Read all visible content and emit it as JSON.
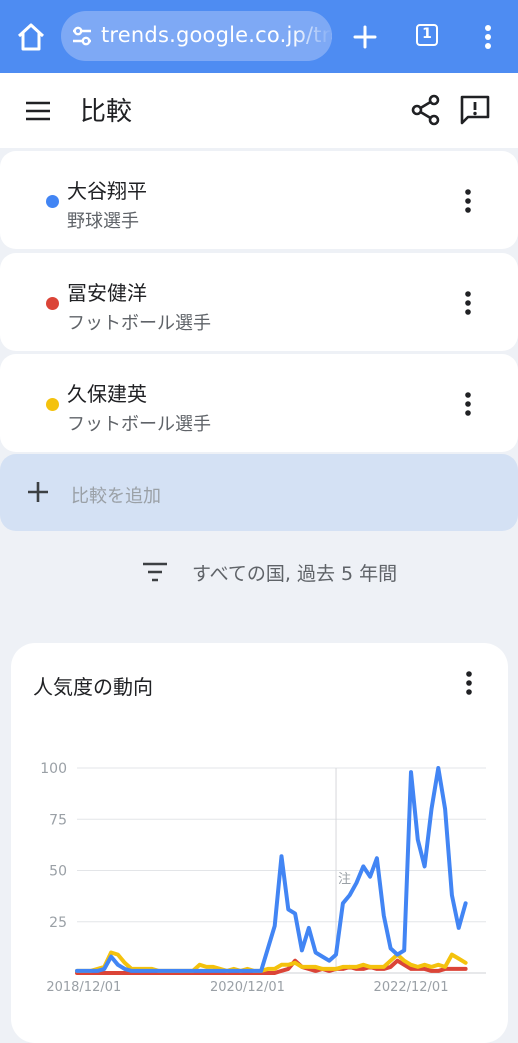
{
  "browser": {
    "url": "trends.google.co.jp/trends/explore",
    "tab_count": "1"
  },
  "header": {
    "title": "比較"
  },
  "terms": [
    {
      "name": "大谷翔平",
      "category": "野球選手",
      "color": "#4285f4"
    },
    {
      "name": "冨安健洋",
      "category": "フットボール選手",
      "color": "#db4437"
    },
    {
      "name": "久保建英",
      "category": "フットボール選手",
      "color": "#f4c20d"
    }
  ],
  "add_compare": {
    "label": "比較を追加"
  },
  "filter": {
    "label": "すべての国, 過去 5 年間"
  },
  "chart_card": {
    "title": "人気度の動向"
  },
  "icons": {
    "home": "home-icon",
    "tune": "tune-icon",
    "plus": "plus-icon",
    "tabs": "tabs-icon",
    "menu": "more-vert-icon",
    "hamburger": "menu-icon",
    "share": "share-icon",
    "feedback": "feedback-icon",
    "filter": "filter-icon"
  },
  "chart_data": {
    "type": "line",
    "title": "",
    "xlabel": "",
    "ylabel": "",
    "ylim": [
      0,
      100
    ],
    "yticks": [
      "100",
      "75",
      "50",
      "25"
    ],
    "xticks": [
      "2018/12/01",
      "2020/12/01",
      "2022/12/01"
    ],
    "note_label": "注",
    "grid": true,
    "legend": "none",
    "x": [
      "2018-11",
      "2018-12",
      "2019-01",
      "2019-02",
      "2019-03",
      "2019-04",
      "2019-05",
      "2019-06",
      "2019-07",
      "2019-08",
      "2019-09",
      "2019-10",
      "2019-11",
      "2019-12",
      "2020-01",
      "2020-02",
      "2020-03",
      "2020-04",
      "2020-05",
      "2020-06",
      "2020-07",
      "2020-08",
      "2020-09",
      "2020-10",
      "2020-11",
      "2020-12",
      "2021-01",
      "2021-02",
      "2021-03",
      "2021-04",
      "2021-05",
      "2021-06",
      "2021-07",
      "2021-08",
      "2021-09",
      "2021-10",
      "2021-11",
      "2021-12",
      "2022-01",
      "2022-02",
      "2022-03",
      "2022-04",
      "2022-05",
      "2022-06",
      "2022-07",
      "2022-08",
      "2022-09",
      "2022-10",
      "2022-11",
      "2022-12",
      "2023-01",
      "2023-02",
      "2023-03",
      "2023-04",
      "2023-05",
      "2023-06",
      "2023-07",
      "2023-08",
      "2023-09",
      "2023-10",
      "2023-11"
    ],
    "series": [
      {
        "name": "大谷翔平",
        "color": "#4285f4",
        "values": [
          1,
          1,
          1,
          1,
          2,
          8,
          4,
          2,
          1,
          1,
          1,
          1,
          1,
          1,
          1,
          1,
          1,
          1,
          1,
          1,
          1,
          1,
          1,
          1,
          1,
          1,
          1,
          1,
          12,
          23,
          57,
          31,
          29,
          11,
          22,
          10,
          8,
          6,
          9,
          34,
          38,
          44,
          52,
          47,
          56,
          28,
          12,
          9,
          11,
          98,
          65,
          52,
          80,
          100,
          80,
          38,
          22,
          34
        ]
      },
      {
        "name": "冨安健洋",
        "color": "#db4437",
        "values": [
          0,
          0,
          0,
          0,
          0,
          0,
          0,
          0,
          0,
          0,
          0,
          0,
          0,
          0,
          0,
          0,
          0,
          0,
          0,
          0,
          0,
          0,
          0,
          0,
          0,
          0,
          0,
          0,
          0,
          0,
          1,
          2,
          6,
          3,
          2,
          1,
          2,
          1,
          2,
          2,
          3,
          2,
          2,
          3,
          2,
          2,
          3,
          6,
          4,
          2,
          2,
          2,
          1,
          1,
          2,
          2,
          2,
          2
        ]
      },
      {
        "name": "久保建英",
        "color": "#f4c20d",
        "values": [
          1,
          1,
          1,
          2,
          3,
          10,
          9,
          5,
          2,
          2,
          2,
          2,
          1,
          1,
          1,
          1,
          1,
          1,
          4,
          3,
          3,
          2,
          1,
          2,
          1,
          2,
          1,
          1,
          2,
          2,
          4,
          4,
          5,
          3,
          3,
          3,
          2,
          2,
          2,
          3,
          3,
          3,
          4,
          3,
          3,
          3,
          6,
          9,
          6,
          4,
          3,
          4,
          3,
          4,
          3,
          9,
          7,
          5
        ]
      }
    ]
  }
}
